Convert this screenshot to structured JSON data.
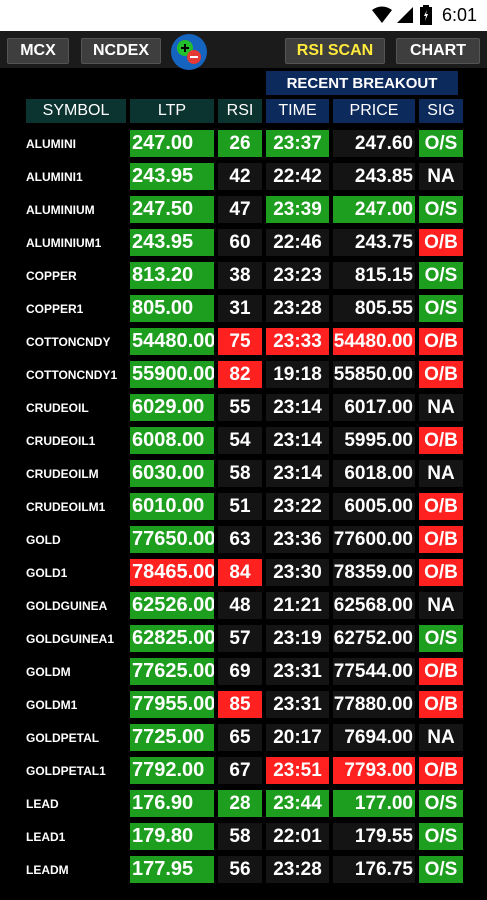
{
  "status_bar": {
    "time": "6:01"
  },
  "toolbar": {
    "buttons": [
      "MCX",
      "NCDEX",
      "RSI SCAN",
      "CHART"
    ]
  },
  "section_title": "RECENT BREAKOUT",
  "columns": [
    "SYMBOL",
    "LTP",
    "RSI",
    "TIME",
    "PRICE",
    "SIG"
  ],
  "colors": {
    "green": "#1e9e1e",
    "red": "#ff2020",
    "neutral": "#141414"
  },
  "rows": [
    {
      "symbol": "ALUMINI",
      "ltp": "247.00",
      "rsi": "26",
      "time": "23:37",
      "price": "247.60",
      "sig": "O/S",
      "ltp_c": "g",
      "rsi_c": "g",
      "time_c": "g",
      "price_c": "n",
      "sig_c": "g"
    },
    {
      "symbol": "ALUMINI1",
      "ltp": "243.95",
      "rsi": "42",
      "time": "22:42",
      "price": "243.85",
      "sig": "NA",
      "ltp_c": "g",
      "rsi_c": "n",
      "time_c": "n",
      "price_c": "n",
      "sig_c": "n"
    },
    {
      "symbol": "ALUMINIUM",
      "ltp": "247.50",
      "rsi": "47",
      "time": "23:39",
      "price": "247.00",
      "sig": "O/S",
      "ltp_c": "g",
      "rsi_c": "n",
      "time_c": "g",
      "price_c": "g",
      "sig_c": "g"
    },
    {
      "symbol": "ALUMINIUM1",
      "ltp": "243.95",
      "rsi": "60",
      "time": "22:46",
      "price": "243.75",
      "sig": "O/B",
      "ltp_c": "g",
      "rsi_c": "n",
      "time_c": "n",
      "price_c": "n",
      "sig_c": "r"
    },
    {
      "symbol": "COPPER",
      "ltp": "813.20",
      "rsi": "38",
      "time": "23:23",
      "price": "815.15",
      "sig": "O/S",
      "ltp_c": "g",
      "rsi_c": "n",
      "time_c": "n",
      "price_c": "n",
      "sig_c": "g"
    },
    {
      "symbol": "COPPER1",
      "ltp": "805.00",
      "rsi": "31",
      "time": "23:28",
      "price": "805.55",
      "sig": "O/S",
      "ltp_c": "g",
      "rsi_c": "n",
      "time_c": "n",
      "price_c": "n",
      "sig_c": "g"
    },
    {
      "symbol": "COTTONCNDY",
      "ltp": "54480.00",
      "rsi": "75",
      "time": "23:33",
      "price": "54480.00",
      "sig": "O/B",
      "ltp_c": "g",
      "rsi_c": "r",
      "time_c": "r",
      "price_c": "r",
      "sig_c": "r"
    },
    {
      "symbol": "COTTONCNDY1",
      "ltp": "55900.00",
      "rsi": "82",
      "time": "19:18",
      "price": "55850.00",
      "sig": "O/B",
      "ltp_c": "g",
      "rsi_c": "r",
      "time_c": "n",
      "price_c": "n",
      "sig_c": "r"
    },
    {
      "symbol": "CRUDEOIL",
      "ltp": "6029.00",
      "rsi": "55",
      "time": "23:14",
      "price": "6017.00",
      "sig": "NA",
      "ltp_c": "g",
      "rsi_c": "n",
      "time_c": "n",
      "price_c": "n",
      "sig_c": "n"
    },
    {
      "symbol": "CRUDEOIL1",
      "ltp": "6008.00",
      "rsi": "54",
      "time": "23:14",
      "price": "5995.00",
      "sig": "O/B",
      "ltp_c": "g",
      "rsi_c": "n",
      "time_c": "n",
      "price_c": "n",
      "sig_c": "r"
    },
    {
      "symbol": "CRUDEOILM",
      "ltp": "6030.00",
      "rsi": "58",
      "time": "23:14",
      "price": "6018.00",
      "sig": "NA",
      "ltp_c": "g",
      "rsi_c": "n",
      "time_c": "n",
      "price_c": "n",
      "sig_c": "n"
    },
    {
      "symbol": "CRUDEOILM1",
      "ltp": "6010.00",
      "rsi": "51",
      "time": "23:22",
      "price": "6005.00",
      "sig": "O/B",
      "ltp_c": "g",
      "rsi_c": "n",
      "time_c": "n",
      "price_c": "n",
      "sig_c": "r"
    },
    {
      "symbol": "GOLD",
      "ltp": "77650.00",
      "rsi": "63",
      "time": "23:36",
      "price": "77600.00",
      "sig": "O/B",
      "ltp_c": "g",
      "rsi_c": "n",
      "time_c": "n",
      "price_c": "n",
      "sig_c": "r"
    },
    {
      "symbol": "GOLD1",
      "ltp": "78465.00",
      "rsi": "84",
      "time": "23:30",
      "price": "78359.00",
      "sig": "O/B",
      "ltp_c": "r",
      "rsi_c": "r",
      "time_c": "n",
      "price_c": "n",
      "sig_c": "r"
    },
    {
      "symbol": "GOLDGUINEA",
      "ltp": "62526.00",
      "rsi": "48",
      "time": "21:21",
      "price": "62568.00",
      "sig": "NA",
      "ltp_c": "g",
      "rsi_c": "n",
      "time_c": "n",
      "price_c": "n",
      "sig_c": "n"
    },
    {
      "symbol": "GOLDGUINEA1",
      "ltp": "62825.00",
      "rsi": "57",
      "time": "23:19",
      "price": "62752.00",
      "sig": "O/S",
      "ltp_c": "g",
      "rsi_c": "n",
      "time_c": "n",
      "price_c": "n",
      "sig_c": "g"
    },
    {
      "symbol": "GOLDM",
      "ltp": "77625.00",
      "rsi": "69",
      "time": "23:31",
      "price": "77544.00",
      "sig": "O/B",
      "ltp_c": "g",
      "rsi_c": "n",
      "time_c": "n",
      "price_c": "n",
      "sig_c": "r"
    },
    {
      "symbol": "GOLDM1",
      "ltp": "77955.00",
      "rsi": "85",
      "time": "23:31",
      "price": "77880.00",
      "sig": "O/B",
      "ltp_c": "g",
      "rsi_c": "r",
      "time_c": "n",
      "price_c": "n",
      "sig_c": "r"
    },
    {
      "symbol": "GOLDPETAL",
      "ltp": "7725.00",
      "rsi": "65",
      "time": "20:17",
      "price": "7694.00",
      "sig": "NA",
      "ltp_c": "g",
      "rsi_c": "n",
      "time_c": "n",
      "price_c": "n",
      "sig_c": "n"
    },
    {
      "symbol": "GOLDPETAL1",
      "ltp": "7792.00",
      "rsi": "67",
      "time": "23:51",
      "price": "7793.00",
      "sig": "O/B",
      "ltp_c": "g",
      "rsi_c": "n",
      "time_c": "r",
      "price_c": "r",
      "sig_c": "r"
    },
    {
      "symbol": "LEAD",
      "ltp": "176.90",
      "rsi": "28",
      "time": "23:44",
      "price": "177.00",
      "sig": "O/S",
      "ltp_c": "g",
      "rsi_c": "g",
      "time_c": "g",
      "price_c": "g",
      "sig_c": "g"
    },
    {
      "symbol": "LEAD1",
      "ltp": "179.80",
      "rsi": "58",
      "time": "22:01",
      "price": "179.55",
      "sig": "O/S",
      "ltp_c": "g",
      "rsi_c": "n",
      "time_c": "n",
      "price_c": "n",
      "sig_c": "g"
    },
    {
      "symbol": "LEADM",
      "ltp": "177.95",
      "rsi": "56",
      "time": "23:28",
      "price": "176.75",
      "sig": "O/S",
      "ltp_c": "g",
      "rsi_c": "n",
      "time_c": "n",
      "price_c": "n",
      "sig_c": "g"
    }
  ]
}
